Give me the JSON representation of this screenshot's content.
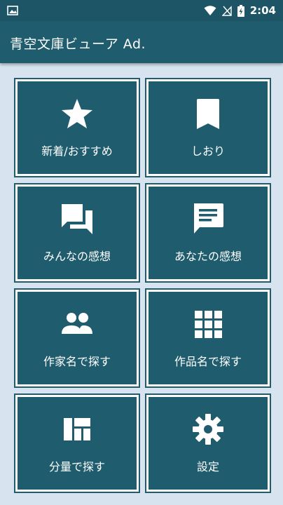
{
  "status_bar": {
    "time": "2:04"
  },
  "app_bar": {
    "title": "青空文庫ビューア Ad."
  },
  "tiles": [
    {
      "label": "新着/おすすめ",
      "icon": "star-icon"
    },
    {
      "label": "しおり",
      "icon": "bookmark-icon"
    },
    {
      "label": "みんなの感想",
      "icon": "forum-icon"
    },
    {
      "label": "あなたの感想",
      "icon": "comment-icon"
    },
    {
      "label": "作家名で探す",
      "icon": "people-icon"
    },
    {
      "label": "作品名で探す",
      "icon": "grid-icon"
    },
    {
      "label": "分量で探す",
      "icon": "dashboard-icon"
    },
    {
      "label": "設定",
      "icon": "gear-icon"
    }
  ],
  "colors": {
    "primary": "#1f5c6d",
    "status_bar": "#1d5566",
    "background": "#d7e3ee",
    "tile_border": "#ffffff"
  }
}
